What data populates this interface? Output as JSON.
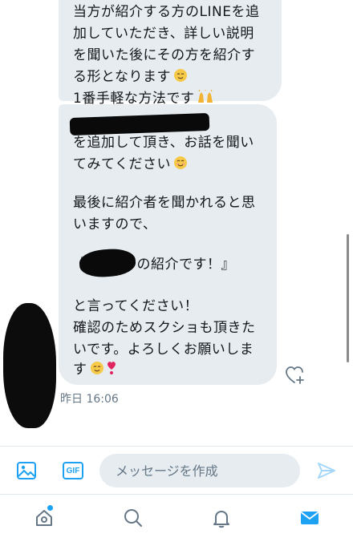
{
  "conversation": {
    "message1": {
      "lines": [
        "当方が紹介する方のLINEを追",
        "加していただき、詳しい説明",
        "を聞いた後にその方を紹介す",
        "る形となります",
        "1番手軽な方法です"
      ],
      "emoji": [
        "relieved-face-emoji",
        "raising-hands-emoji"
      ]
    },
    "message2": {
      "lines": [
        "を追加して頂き、お話を聞い",
        "てみてください",
        "最後に紹介者を聞かれると思",
        "いますので、",
        "『",
        "の紹介です！』",
        "と言ってください！",
        "確認のためスクショも頂きた",
        "いです。よろしくお願いしま",
        "す"
      ],
      "emoji": [
        "smiling-face-emoji",
        "relieved-face-emoji",
        "heart-exclamation-emoji"
      ]
    },
    "timestamp": "昨日 16:06"
  },
  "composer": {
    "gif_label": "GIF",
    "placeholder": "メッセージを作成"
  },
  "tabs": [
    "home-icon",
    "search-icon",
    "notifications-icon",
    "messages-icon"
  ],
  "colors": {
    "accent": "#1da1f2",
    "bubble": "#e6ecf0",
    "secondary_text": "#657786"
  }
}
